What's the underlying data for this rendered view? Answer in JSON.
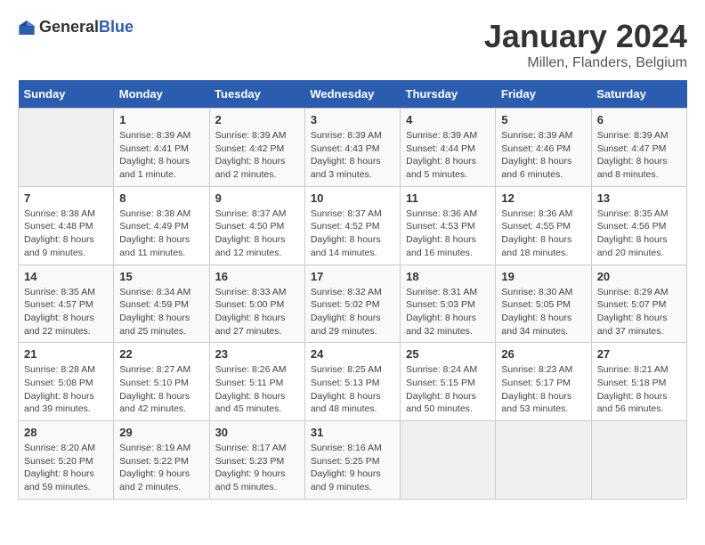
{
  "logo": {
    "text_general": "General",
    "text_blue": "Blue"
  },
  "title": "January 2024",
  "subtitle": "Millen, Flanders, Belgium",
  "days_of_week": [
    "Sunday",
    "Monday",
    "Tuesday",
    "Wednesday",
    "Thursday",
    "Friday",
    "Saturday"
  ],
  "weeks": [
    [
      {
        "day": "",
        "sunrise": "",
        "sunset": "",
        "daylight": "",
        "empty": true
      },
      {
        "day": "1",
        "sunrise": "Sunrise: 8:39 AM",
        "sunset": "Sunset: 4:41 PM",
        "daylight": "Daylight: 8 hours and 1 minute."
      },
      {
        "day": "2",
        "sunrise": "Sunrise: 8:39 AM",
        "sunset": "Sunset: 4:42 PM",
        "daylight": "Daylight: 8 hours and 2 minutes."
      },
      {
        "day": "3",
        "sunrise": "Sunrise: 8:39 AM",
        "sunset": "Sunset: 4:43 PM",
        "daylight": "Daylight: 8 hours and 3 minutes."
      },
      {
        "day": "4",
        "sunrise": "Sunrise: 8:39 AM",
        "sunset": "Sunset: 4:44 PM",
        "daylight": "Daylight: 8 hours and 5 minutes."
      },
      {
        "day": "5",
        "sunrise": "Sunrise: 8:39 AM",
        "sunset": "Sunset: 4:46 PM",
        "daylight": "Daylight: 8 hours and 6 minutes."
      },
      {
        "day": "6",
        "sunrise": "Sunrise: 8:39 AM",
        "sunset": "Sunset: 4:47 PM",
        "daylight": "Daylight: 8 hours and 8 minutes."
      }
    ],
    [
      {
        "day": "7",
        "sunrise": "Sunrise: 8:38 AM",
        "sunset": "Sunset: 4:48 PM",
        "daylight": "Daylight: 8 hours and 9 minutes."
      },
      {
        "day": "8",
        "sunrise": "Sunrise: 8:38 AM",
        "sunset": "Sunset: 4:49 PM",
        "daylight": "Daylight: 8 hours and 11 minutes."
      },
      {
        "day": "9",
        "sunrise": "Sunrise: 8:37 AM",
        "sunset": "Sunset: 4:50 PM",
        "daylight": "Daylight: 8 hours and 12 minutes."
      },
      {
        "day": "10",
        "sunrise": "Sunrise: 8:37 AM",
        "sunset": "Sunset: 4:52 PM",
        "daylight": "Daylight: 8 hours and 14 minutes."
      },
      {
        "day": "11",
        "sunrise": "Sunrise: 8:36 AM",
        "sunset": "Sunset: 4:53 PM",
        "daylight": "Daylight: 8 hours and 16 minutes."
      },
      {
        "day": "12",
        "sunrise": "Sunrise: 8:36 AM",
        "sunset": "Sunset: 4:55 PM",
        "daylight": "Daylight: 8 hours and 18 minutes."
      },
      {
        "day": "13",
        "sunrise": "Sunrise: 8:35 AM",
        "sunset": "Sunset: 4:56 PM",
        "daylight": "Daylight: 8 hours and 20 minutes."
      }
    ],
    [
      {
        "day": "14",
        "sunrise": "Sunrise: 8:35 AM",
        "sunset": "Sunset: 4:57 PM",
        "daylight": "Daylight: 8 hours and 22 minutes."
      },
      {
        "day": "15",
        "sunrise": "Sunrise: 8:34 AM",
        "sunset": "Sunset: 4:59 PM",
        "daylight": "Daylight: 8 hours and 25 minutes."
      },
      {
        "day": "16",
        "sunrise": "Sunrise: 8:33 AM",
        "sunset": "Sunset: 5:00 PM",
        "daylight": "Daylight: 8 hours and 27 minutes."
      },
      {
        "day": "17",
        "sunrise": "Sunrise: 8:32 AM",
        "sunset": "Sunset: 5:02 PM",
        "daylight": "Daylight: 8 hours and 29 minutes."
      },
      {
        "day": "18",
        "sunrise": "Sunrise: 8:31 AM",
        "sunset": "Sunset: 5:03 PM",
        "daylight": "Daylight: 8 hours and 32 minutes."
      },
      {
        "day": "19",
        "sunrise": "Sunrise: 8:30 AM",
        "sunset": "Sunset: 5:05 PM",
        "daylight": "Daylight: 8 hours and 34 minutes."
      },
      {
        "day": "20",
        "sunrise": "Sunrise: 8:29 AM",
        "sunset": "Sunset: 5:07 PM",
        "daylight": "Daylight: 8 hours and 37 minutes."
      }
    ],
    [
      {
        "day": "21",
        "sunrise": "Sunrise: 8:28 AM",
        "sunset": "Sunset: 5:08 PM",
        "daylight": "Daylight: 8 hours and 39 minutes."
      },
      {
        "day": "22",
        "sunrise": "Sunrise: 8:27 AM",
        "sunset": "Sunset: 5:10 PM",
        "daylight": "Daylight: 8 hours and 42 minutes."
      },
      {
        "day": "23",
        "sunrise": "Sunrise: 8:26 AM",
        "sunset": "Sunset: 5:11 PM",
        "daylight": "Daylight: 8 hours and 45 minutes."
      },
      {
        "day": "24",
        "sunrise": "Sunrise: 8:25 AM",
        "sunset": "Sunset: 5:13 PM",
        "daylight": "Daylight: 8 hours and 48 minutes."
      },
      {
        "day": "25",
        "sunrise": "Sunrise: 8:24 AM",
        "sunset": "Sunset: 5:15 PM",
        "daylight": "Daylight: 8 hours and 50 minutes."
      },
      {
        "day": "26",
        "sunrise": "Sunrise: 8:23 AM",
        "sunset": "Sunset: 5:17 PM",
        "daylight": "Daylight: 8 hours and 53 minutes."
      },
      {
        "day": "27",
        "sunrise": "Sunrise: 8:21 AM",
        "sunset": "Sunset: 5:18 PM",
        "daylight": "Daylight: 8 hours and 56 minutes."
      }
    ],
    [
      {
        "day": "28",
        "sunrise": "Sunrise: 8:20 AM",
        "sunset": "Sunset: 5:20 PM",
        "daylight": "Daylight: 8 hours and 59 minutes."
      },
      {
        "day": "29",
        "sunrise": "Sunrise: 8:19 AM",
        "sunset": "Sunset: 5:22 PM",
        "daylight": "Daylight: 9 hours and 2 minutes."
      },
      {
        "day": "30",
        "sunrise": "Sunrise: 8:17 AM",
        "sunset": "Sunset: 5:23 PM",
        "daylight": "Daylight: 9 hours and 5 minutes."
      },
      {
        "day": "31",
        "sunrise": "Sunrise: 8:16 AM",
        "sunset": "Sunset: 5:25 PM",
        "daylight": "Daylight: 9 hours and 9 minutes."
      },
      {
        "day": "",
        "sunrise": "",
        "sunset": "",
        "daylight": "",
        "empty": true
      },
      {
        "day": "",
        "sunrise": "",
        "sunset": "",
        "daylight": "",
        "empty": true
      },
      {
        "day": "",
        "sunrise": "",
        "sunset": "",
        "daylight": "",
        "empty": true
      }
    ]
  ]
}
